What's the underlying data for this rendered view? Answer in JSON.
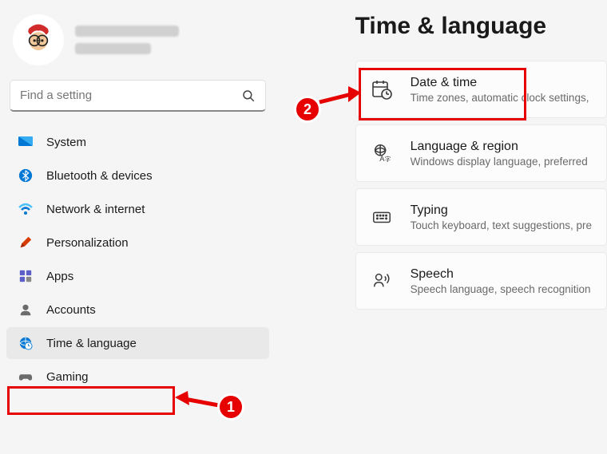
{
  "search": {
    "placeholder": "Find a setting"
  },
  "sidebar": {
    "items": [
      {
        "label": "System"
      },
      {
        "label": "Bluetooth & devices"
      },
      {
        "label": "Network & internet"
      },
      {
        "label": "Personalization"
      },
      {
        "label": "Apps"
      },
      {
        "label": "Accounts"
      },
      {
        "label": "Time & language"
      },
      {
        "label": "Gaming"
      }
    ]
  },
  "page": {
    "title": "Time & language"
  },
  "cards": [
    {
      "title": "Date & time",
      "sub": "Time zones, automatic clock settings,"
    },
    {
      "title": "Language & region",
      "sub": "Windows display language, preferred"
    },
    {
      "title": "Typing",
      "sub": "Touch keyboard, text suggestions, pre"
    },
    {
      "title": "Speech",
      "sub": "Speech language, speech recognition"
    }
  ],
  "annotations": {
    "badge1": "1",
    "badge2": "2"
  }
}
